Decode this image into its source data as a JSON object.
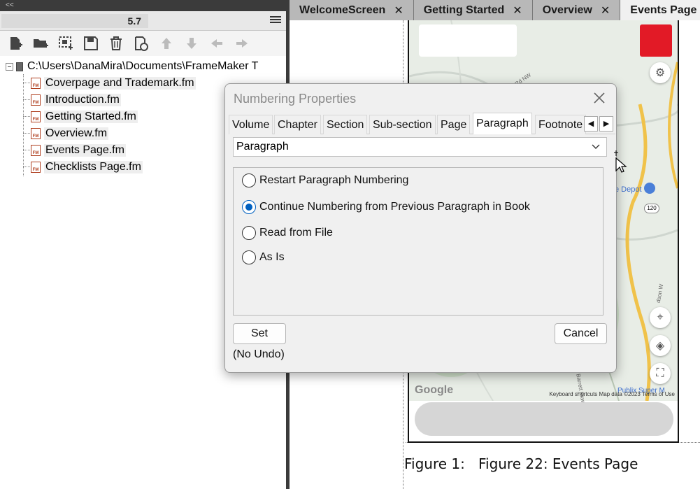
{
  "book_panel": {
    "collapse_glyph": "<<",
    "version": "5.7",
    "toolbar_icons": [
      "add-file-icon",
      "add-folder-icon",
      "add-group-icon",
      "save-icon",
      "delete-icon",
      "update-book-icon",
      "move-up-icon",
      "move-down-icon",
      "move-left-icon",
      "move-right-icon"
    ],
    "root_path": "C:\\Users\\DanaMira\\Documents\\FrameMaker T",
    "files": [
      "Coverpage and Trademark.fm",
      "Introduction.fm",
      "Getting Started.fm",
      "Overview.fm",
      "Events Page.fm",
      "Checklists Page.fm"
    ]
  },
  "tabs": [
    {
      "label": "WelcomeScreen",
      "close": "✕"
    },
    {
      "label": "Getting Started",
      "close": "✕"
    },
    {
      "label": "Overview",
      "close": "✕"
    },
    {
      "label": "Events Page",
      "close": ""
    }
  ],
  "map": {
    "google_logo": "Google",
    "attribution": "Keyboard shortcuts   Map data ©2023   Terms of Use",
    "labels": {
      "depot": "e Depot",
      "road_sign": "120",
      "street": "Ernest W Barrett Pkwy SW",
      "store": "Publix Super M",
      "road_nw": "Rd NW",
      "street2": "dson W"
    }
  },
  "figure_caption": "Figure 1:   Figure 22: Events Page",
  "dialog": {
    "title": "Numbering Properties",
    "tabs": [
      "Volume",
      "Chapter",
      "Section",
      "Sub-section",
      "Page",
      "Paragraph",
      "Footnote"
    ],
    "active_tab": "Paragraph",
    "select_value": "Paragraph",
    "options": [
      {
        "label": "Restart Paragraph Numbering",
        "checked": false
      },
      {
        "label": "Continue Numbering from Previous Paragraph in Book",
        "checked": true
      },
      {
        "label": "Read from File",
        "checked": false
      },
      {
        "label": "As Is",
        "checked": false
      }
    ],
    "set_label": "Set",
    "cancel_label": "Cancel",
    "undo_note": "(No Undo)"
  },
  "colors": {
    "accent": "#0060c0",
    "map_red": "#e21a26",
    "dark_chrome": "#3b3b3b"
  }
}
